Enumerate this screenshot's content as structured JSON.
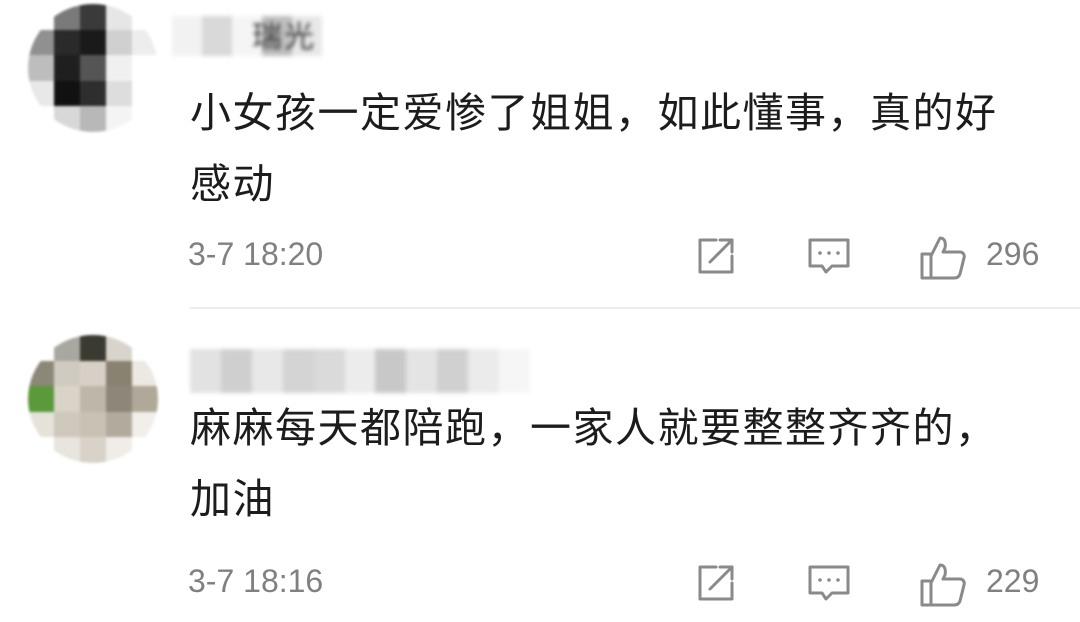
{
  "comments": [
    {
      "username_visible": "瑞光",
      "text": "小女孩一定爱惨了姐姐，如此懂事，真的好感动",
      "time": "3-7 18:20",
      "likes": "296"
    },
    {
      "username_visible": "",
      "text": "麻麻每天都陪跑，一家人就要整整齐齐的，加油",
      "time": "3-7 18:16",
      "likes": "229"
    }
  ],
  "icons": {
    "share": "share-icon",
    "reply": "comment-icon",
    "like": "thumbs-up-icon"
  },
  "colors": {
    "text": "#1c1c1c",
    "meta": "#808080",
    "icon": "#8a8a8a",
    "divider": "#ececec"
  }
}
